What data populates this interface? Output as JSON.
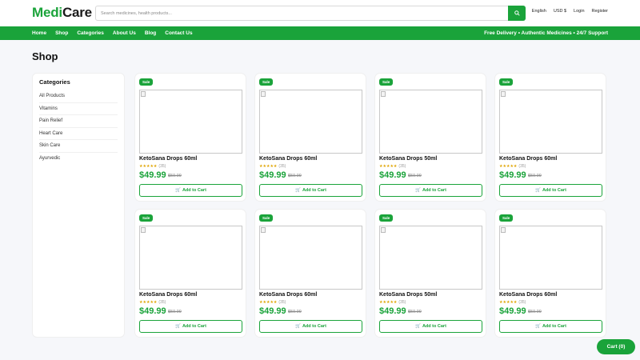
{
  "header": {
    "logo_part1": "Medi",
    "logo_part2": "Care",
    "search_placeholder": "Search medicines, health products...",
    "search_icon": "search-icon",
    "links": [
      "English",
      "USD $",
      "Login",
      "Register"
    ]
  },
  "nav": {
    "items": [
      "Home",
      "Shop",
      "Categories",
      "About Us",
      "Blog",
      "Contact Us"
    ],
    "banner": "Free Delivery • Authentic Medicines • 24/7 Support"
  },
  "page_title": "Shop",
  "sidebar": {
    "title": "Categories",
    "items": [
      "All Products",
      "Vitamins",
      "Pain Relief",
      "Heart Care",
      "Skin Care",
      "Ayurvedic"
    ]
  },
  "products": [
    {
      "badge": "Sale",
      "name": "KetoSana Drops 60ml",
      "stars": "★★★★★",
      "reviews": "(35)",
      "price": "$49.99",
      "old_price": "$59.99",
      "button": "Add to Cart"
    },
    {
      "badge": "Sale",
      "name": "KetoSana Drops 60ml",
      "stars": "★★★★★",
      "reviews": "(35)",
      "price": "$49.99",
      "old_price": "$59.99",
      "button": "Add to Cart"
    },
    {
      "badge": "Sale",
      "name": "KetoSana Drops 50ml",
      "stars": "★★★★★",
      "reviews": "(35)",
      "price": "$49.99",
      "old_price": "$59.99",
      "button": "Add to Cart"
    },
    {
      "badge": "Sale",
      "name": "KetoSana Drops 60ml",
      "stars": "★★★★★",
      "reviews": "(35)",
      "price": "$49.99",
      "old_price": "$59.99",
      "button": "Add to Cart"
    },
    {
      "badge": "Sale",
      "name": "KetoSana Drops 60ml",
      "stars": "★★★★★",
      "reviews": "(35)",
      "price": "$49.99",
      "old_price": "$59.99",
      "button": "Add to Cart"
    },
    {
      "badge": "Sale",
      "name": "KetoSana Drops 60ml",
      "stars": "★★★★★",
      "reviews": "(35)",
      "price": "$49.99",
      "old_price": "$59.99",
      "button": "Add to Cart"
    },
    {
      "badge": "Sale",
      "name": "KetoSana Drops 50ml",
      "stars": "★★★★★",
      "reviews": "(35)",
      "price": "$49.99",
      "old_price": "$59.99",
      "button": "Add to Cart"
    },
    {
      "badge": "Sale",
      "name": "KetoSana Drops 60ml",
      "stars": "★★★★★",
      "reviews": "(35)",
      "price": "$49.99",
      "old_price": "$59.99",
      "button": "Add to Cart"
    }
  ],
  "cart_button": "Cart (0)",
  "colors": {
    "brand": "#1aa33a",
    "background": "#f6f7fa",
    "star": "#e0a400"
  }
}
